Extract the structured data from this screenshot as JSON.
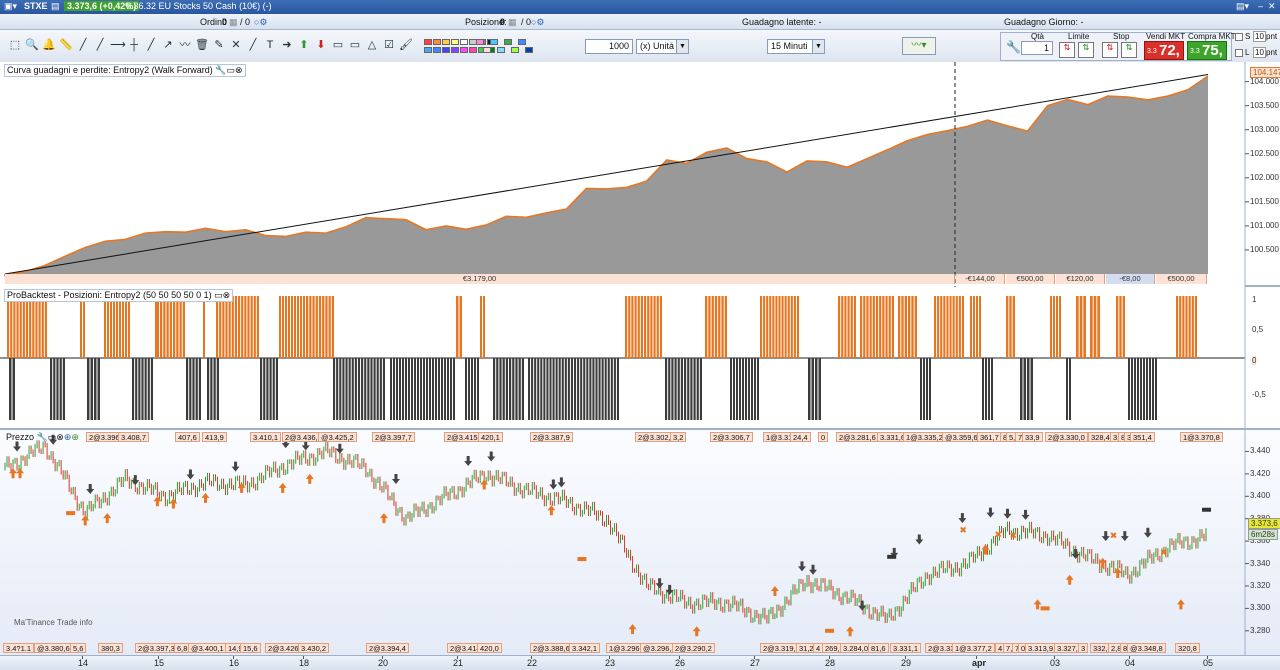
{
  "titlebar": {
    "symbol": "STXE",
    "price": "3.373,6 (+0,42%)",
    "description": "0.36.32 EU Stocks 50 Cash (10€) (-)"
  },
  "infobar": {
    "orders_label": "Ordini:",
    "orders_value": "0",
    "orders_sep": "/ 0",
    "position_label": "Posizione:",
    "position_value": "0",
    "position_sep": "/ 0",
    "latent_gain": "Guadagno latente: -",
    "day_gain": "Guadagno Giorno: -"
  },
  "toolbar": {
    "quantity": "1000",
    "unit": "(x) Unità",
    "timeframe": "15 Minuti",
    "qty_label": "Qtà",
    "qty_value": "1",
    "limit_label": "Limite",
    "stop_label": "Stop",
    "sell_label": "Vendi MKT",
    "buy_label": "Compra MKT",
    "sell_price": "72,",
    "buy_price": "75,",
    "sell_prefix": "3.3",
    "buy_prefix": "3.3",
    "s_label": "S",
    "l_label": "L",
    "s_value": "10",
    "l_value": "10",
    "pnt": "pnt"
  },
  "panel1": {
    "title": "Curva guadagni e perdite: Entropy2 (Walk Forward)",
    "yticks": [
      "104.000",
      "103.500",
      "103.000",
      "102.500",
      "102.000",
      "101.500",
      "101.000",
      "100.500"
    ],
    "last_value": "104.147",
    "footer": [
      "€3.179,00",
      "-€144,00",
      "€500,00",
      "€120,00",
      "-€8,00",
      "€500,00"
    ]
  },
  "panel2": {
    "title": "ProBacktest - Posizioni: Entropy2 (50 50 50 50 0 1)",
    "yticks": [
      "1",
      "0,5",
      "0",
      "-0,5"
    ]
  },
  "panel3": {
    "title": "Prezzo",
    "yticks": [
      "3.440",
      "3.420",
      "3.400",
      "3.380",
      "3.360",
      "3.340",
      "3.320",
      "3.300",
      "3.280"
    ],
    "last_price": "3.373,6",
    "time_left": "6m28s",
    "mark_text": "Ma'Tinance Trade info",
    "top_labels": [
      "2@3.396",
      "3.408,7",
      "407,6",
      "413,9",
      "3.410,1",
      "2@3.436,2",
      "@3.425,2",
      "2@3.397,7",
      "2@3.415,3",
      "420,1",
      "2@3.387,9",
      "2@3.302,6",
      "3,2",
      "2@3.306,7",
      "1@3.318,0",
      "24,4",
      "0",
      "2@3.281,6",
      "3.331,6",
      "1@3.335,2",
      "@3.359,6",
      "361,7",
      "8",
      "5,3",
      "7",
      "33,9",
      "2@3.330,0",
      "328,4",
      "3,5",
      "8",
      "3",
      "351,4",
      "1@3.370,8"
    ],
    "bottom_labels": [
      "3.4?1.1",
      "@3.380,6",
      "5,6",
      "380,3",
      "2@3.397,3",
      "6,8",
      "@3.400,1",
      "14,9",
      "15,6",
      "2@3.426,1",
      "3.430,2",
      "2@3.394,4",
      "2@3.414,5",
      "420,0",
      "2@3.388,6",
      "3.342,1",
      "1@3.296,6",
      "@3.296,2",
      "2@3.290,2",
      "2@3.319,9",
      "31,2",
      "4",
      "269,0",
      "3.284,0",
      "81,6",
      "3.331,1",
      "2@3.334,5",
      "1@3.377,2",
      "4",
      "7,5",
      "7",
      "0",
      "3.313,9",
      "3.327,0",
      "3",
      "332,4",
      "2,8",
      "8",
      "@3.348,8",
      "320,8"
    ]
  },
  "xaxis": {
    "labels": [
      "14",
      "15",
      "16",
      "18",
      "20",
      "21",
      "22",
      "23",
      "26",
      "27",
      "28",
      "29",
      "apr",
      "03",
      "04",
      "05"
    ]
  },
  "chart_data": [
    {
      "type": "area",
      "title": "Curva guadagni e perdite: Entropy2 (Walk Forward)",
      "ylim": [
        100000,
        104200
      ],
      "x": [
        0,
        20,
        40,
        60,
        80,
        100,
        120,
        140,
        160,
        180,
        200,
        220,
        240,
        260,
        280,
        300,
        320,
        340,
        360,
        380,
        400,
        420,
        440,
        460,
        480,
        500,
        520,
        540,
        560,
        580,
        600,
        620,
        640,
        660,
        680,
        700,
        720,
        740,
        760,
        780,
        800,
        820,
        840,
        860,
        880,
        900,
        920,
        940,
        960,
        980,
        1000,
        1020,
        1040,
        1060,
        1080,
        1100,
        1120,
        1140,
        1160,
        1180,
        1200
      ],
      "y": [
        100000,
        100050,
        100150,
        100400,
        100550,
        100650,
        100750,
        100850,
        100850,
        100900,
        100950,
        100850,
        100950,
        100800,
        100750,
        100900,
        100850,
        100950,
        101200,
        101150,
        101100,
        100950,
        101000,
        100900,
        101050,
        101200,
        101150,
        101300,
        101350,
        101750,
        101800,
        101800,
        101900,
        102400,
        102300,
        102500,
        102650,
        102400,
        102300,
        102150,
        102350,
        102300,
        102250,
        102400,
        102550,
        102800,
        102900,
        102950,
        103100,
        103200,
        103050,
        103000,
        103500,
        103600,
        103550,
        103700,
        103650,
        103650,
        103700,
        103800,
        104147
      ]
    },
    {
      "type": "bar",
      "title": "ProBacktest - Posizioni: Entropy2 (50 50 50 50 0 1)",
      "ylim": [
        -1,
        1
      ],
      "series": [
        {
          "values": [
            1,
            -1,
            1,
            -1,
            1,
            -1,
            1,
            -1,
            1,
            -1,
            1,
            -1,
            1,
            -1,
            1,
            -1,
            1,
            -1,
            1,
            -1,
            1,
            -1,
            1,
            -1,
            1,
            -1,
            1,
            -1,
            1
          ]
        }
      ]
    },
    {
      "type": "line",
      "title": "Prezzo",
      "ylim": [
        3270,
        3452
      ],
      "x": [
        0,
        40,
        80,
        120,
        160,
        200,
        240,
        280,
        320,
        360,
        400,
        440,
        480,
        520,
        560,
        600,
        640,
        680,
        720,
        760,
        800,
        840,
        880,
        920,
        960,
        1000,
        1040,
        1080,
        1120,
        1160,
        1200
      ],
      "y": [
        3425,
        3445,
        3385,
        3415,
        3400,
        3412,
        3410,
        3428,
        3440,
        3425,
        3380,
        3400,
        3420,
        3405,
        3395,
        3380,
        3320,
        3305,
        3305,
        3290,
        3325,
        3310,
        3290,
        3330,
        3340,
        3370,
        3365,
        3345,
        3330,
        3355,
        3365,
        3305,
        3374
      ]
    }
  ]
}
